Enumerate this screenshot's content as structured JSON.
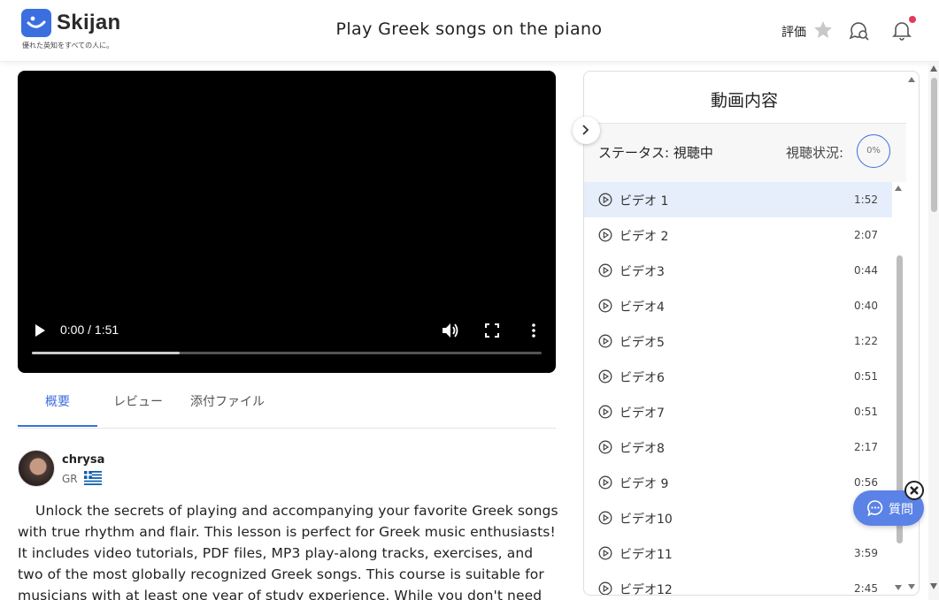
{
  "brand": {
    "name": "Skijan",
    "tagline": "優れた英知をすべての人に。",
    "color": "#3b6fe0"
  },
  "header": {
    "title": "Play Greek songs on the piano",
    "rating_label": "評価",
    "notification_dot_color": "#e5395b"
  },
  "video": {
    "time": "0:00 / 1:51",
    "progress_loaded": 0.29
  },
  "tabs": [
    {
      "label": "概要",
      "active": true
    },
    {
      "label": "レビュー",
      "active": false
    },
    {
      "label": "添付ファイル",
      "active": false
    }
  ],
  "author": {
    "name": "chrysa",
    "country": "GR"
  },
  "description": "Unlock the secrets of playing and accompanying your favorite Greek songs with true rhythm and flair. This lesson is perfect for Greek music enthusiasts! It includes video tutorials, PDF files, MP3 play-along tracks, exercises, and two of the most globally recognized Greek songs. This course is suitable for musicians with at least one year of study experience. While you don't need to",
  "panel": {
    "title": "動画内容",
    "status": "ステータス: 視聴中",
    "watch_label": "視聴状況:",
    "watch_percent": "0%",
    "items": [
      {
        "label": "ビデオ 1",
        "duration": "1:52",
        "active": true
      },
      {
        "label": "ビデオ 2",
        "duration": "2:07",
        "active": false
      },
      {
        "label": "ビデオ3",
        "duration": "0:44",
        "active": false
      },
      {
        "label": "ビデオ4",
        "duration": "0:40",
        "active": false
      },
      {
        "label": "ビデオ5",
        "duration": "1:22",
        "active": false
      },
      {
        "label": "ビデオ6",
        "duration": "0:51",
        "active": false
      },
      {
        "label": "ビデオ7",
        "duration": "0:51",
        "active": false
      },
      {
        "label": "ビデオ8",
        "duration": "2:17",
        "active": false
      },
      {
        "label": "ビデオ 9",
        "duration": "0:56",
        "active": false
      },
      {
        "label": "ビデオ10",
        "duration": "",
        "active": false
      },
      {
        "label": "ビデオ11",
        "duration": "3:59",
        "active": false
      },
      {
        "label": "ビデオ12",
        "duration": "2:45",
        "active": false
      }
    ]
  },
  "question_button": {
    "label": "質問"
  }
}
